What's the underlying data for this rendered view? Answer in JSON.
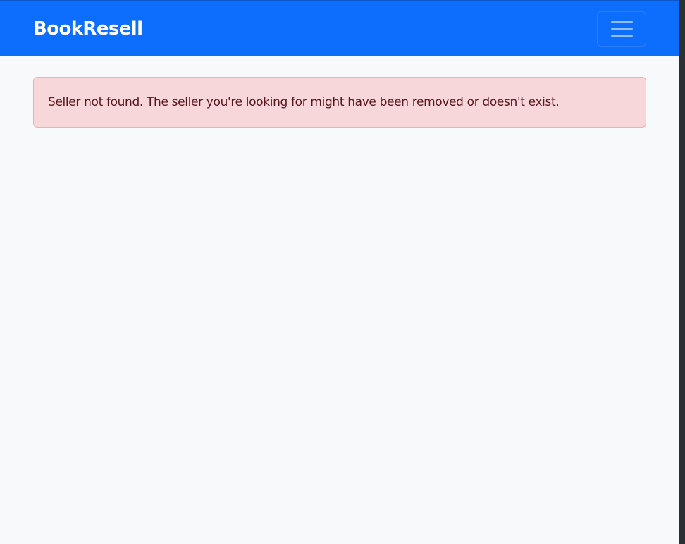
{
  "navbar": {
    "brand": "BookResell",
    "toggler_icon": "hamburger-menu-icon",
    "background_color": "#0d6efd"
  },
  "alert": {
    "type": "danger",
    "message": "Seller not found. The seller you're looking for might have been removed or doesn't exist.",
    "background_color": "#f8d7da",
    "text_color": "#58151c"
  }
}
